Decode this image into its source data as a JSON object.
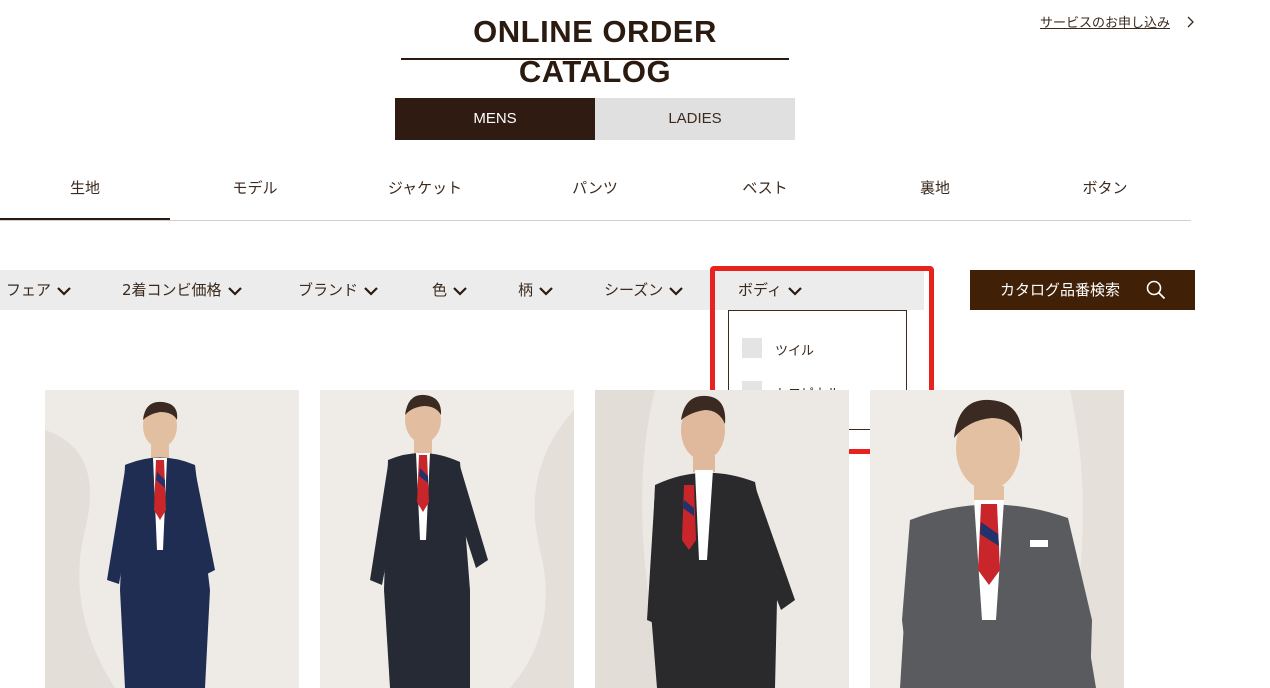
{
  "header": {
    "title": "ONLINE ORDER CATALOG",
    "service_link": "サービスのお申し込み"
  },
  "gender_toggle": {
    "mens": "MENS",
    "ladies": "LADIES",
    "selected": "MENS"
  },
  "tabs": [
    "生地",
    "モデル",
    "ジャケット",
    "パンツ",
    "ベスト",
    "裏地",
    "ボタン"
  ],
  "active_tab": "生地",
  "filters": [
    "フェア",
    "2着コンビ価格",
    "ブランド",
    "色",
    "柄",
    "シーズン",
    "ボディ"
  ],
  "open_filter": "ボディ",
  "catalog_search": {
    "label": "カタログ品番検索",
    "icon": "search-icon"
  },
  "body_dropdown": {
    "options": [
      {
        "label": "ツイル",
        "checked": false
      },
      {
        "label": "トロピカル",
        "checked": false
      }
    ]
  },
  "products": [
    {
      "suit_color": "#1f2d52",
      "tie": "red-navy-stripe"
    },
    {
      "suit_color": "#262a34",
      "tie": "red-navy-stripe"
    },
    {
      "suit_color": "#2a2a2c",
      "tie": "red-navy-stripe"
    },
    {
      "suit_color": "#5a5b5e",
      "tie": "red-navy-stripe"
    }
  ],
  "colors": {
    "brand_dark": "#301b12",
    "search_button": "#402006",
    "annotation_red": "#e8221e",
    "filter_bar_bg": "#ececec"
  }
}
